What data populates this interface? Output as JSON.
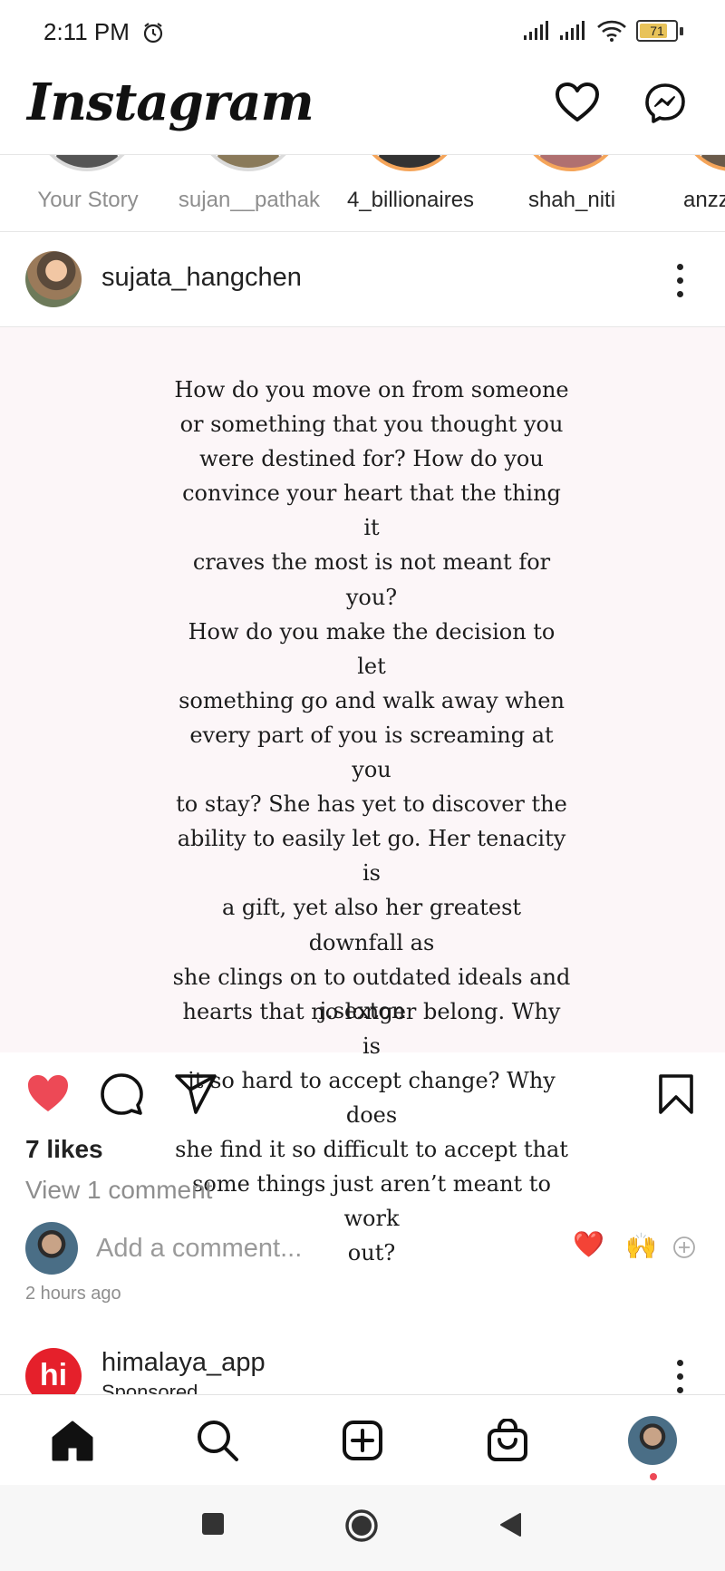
{
  "status_bar": {
    "time": "2:11 PM",
    "battery": "71",
    "icons": [
      "alarm-icon",
      "signal-icon",
      "signal-icon",
      "wifi-icon",
      "battery-icon"
    ]
  },
  "header": {
    "logo": "Instagram",
    "icons": [
      "heart-icon",
      "messenger-icon"
    ]
  },
  "stories": [
    {
      "label": "Your Story",
      "seen": true
    },
    {
      "label": "sujan__pathak",
      "seen": true
    },
    {
      "label": "4_billionaires",
      "seen": false
    },
    {
      "label": "shah_niti",
      "seen": false
    },
    {
      "label": "anzz",
      "seen": false
    }
  ],
  "post": {
    "username": "sujata_hangchen",
    "quote_lines": [
      "How do you move on from someone",
      "or something that you thought you",
      "were destined for? How do you",
      "convince your heart that the thing it",
      "craves the most is not meant for you?",
      "How do you make the decision to let",
      "something go and walk away when",
      "every part of you is screaming at you",
      "to stay? She has yet to discover the",
      "ability to easily let go. Her tenacity is",
      "a gift, yet also her greatest downfall as",
      "she clings on to outdated ideals and",
      "hearts that no longer belong. Why is",
      "it so hard to accept change? Why does",
      "she find it so difficult to accept that",
      "some things just aren’t meant to work",
      "out?"
    ],
    "quote_author": "j.sexton",
    "liked": true,
    "likes": "7 likes",
    "view_comments": "View 1 comment",
    "add_comment_placeholder": "Add a comment...",
    "quick_reactions": [
      "❤️",
      "🙌"
    ],
    "time_ago": "2 hours ago"
  },
  "next_post": {
    "logo_text": "hi",
    "username": "himalaya_app",
    "sponsored": "Sponsored"
  },
  "bottom_nav": [
    "home-icon",
    "search-icon",
    "new-post-icon",
    "shop-icon",
    "profile-avatar"
  ],
  "colors": {
    "like_red": "#ed4956",
    "story_ring": "#f5a55a",
    "sponsor_red": "#e5202b"
  }
}
